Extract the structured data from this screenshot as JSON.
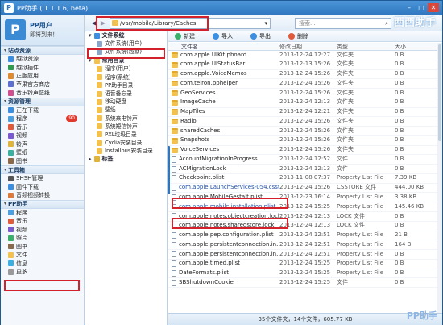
{
  "window": {
    "title": "PP助手 ( 1.1.1.6, beta)",
    "logo": "P",
    "min": "–",
    "max": "□",
    "close": "✕"
  },
  "user": {
    "name": "PP用户",
    "greeting": "即将到来！"
  },
  "left_sections": [
    {
      "title": "站点资源",
      "items": [
        {
          "label": "越狱资源",
          "icon_color": "#3b8ee0"
        },
        {
          "label": "越狱插件",
          "icon_color": "#2e9b4f"
        },
        {
          "label": "正版应用",
          "icon_color": "#e08a2f"
        },
        {
          "label": "苹果官方商店",
          "icon_color": "#5a6fd0"
        },
        {
          "label": "音乐铃声壁纸",
          "icon_color": "#d04f8f"
        }
      ]
    },
    {
      "title": "资源管理",
      "items": [
        {
          "label": "正在下载",
          "icon_color": "#3b8ee0"
        },
        {
          "label": "程序",
          "icon_color": "#4aa0e0",
          "badge": "90"
        },
        {
          "label": "音乐",
          "icon_color": "#e05a3b"
        },
        {
          "label": "视频",
          "icon_color": "#7a5ad0"
        },
        {
          "label": "铃声",
          "icon_color": "#e0b43b"
        },
        {
          "label": "壁纸",
          "icon_color": "#3bb0a0"
        },
        {
          "label": "图书",
          "icon_color": "#8a6a4a"
        }
      ]
    },
    {
      "title": "工具箱",
      "items": [
        {
          "label": "SHSH管理",
          "icon_color": "#555555"
        },
        {
          "label": "固件下载",
          "icon_color": "#3b8ee0"
        },
        {
          "label": "音频视频转换",
          "icon_color": "#e07a3b"
        }
      ]
    },
    {
      "title": "PP助手",
      "items": [
        {
          "label": "程序",
          "icon_color": "#4aa0e0"
        },
        {
          "label": "音乐",
          "icon_color": "#e05a3b"
        },
        {
          "label": "视频",
          "icon_color": "#7a5ad0"
        },
        {
          "label": "照片",
          "icon_color": "#3bb06a"
        },
        {
          "label": "图书",
          "icon_color": "#8a6a4a"
        },
        {
          "label": "文件",
          "icon_color": "#f2c14e"
        },
        {
          "label": "信息",
          "icon_color": "#3bb0e0"
        },
        {
          "label": "更多",
          "icon_color": "#999999"
        }
      ]
    }
  ],
  "path": {
    "back": "◀",
    "forward": "▶",
    "value": "/var/mobile/Library/Caches",
    "dropdown": "▾",
    "search_placeholder": "搜索...",
    "search_icon": "⌕"
  },
  "brand": "西西助手",
  "tree": {
    "fs_title": "文件系统",
    "fs_items": [
      "文件系统(用户)",
      "文件系统(越狱)"
    ],
    "common_title": "常用目录",
    "common_items": [
      "程序(用户)",
      "程序(系统)",
      "PP助手目录",
      "语音备忘录",
      "移动硬盘",
      "壁纸",
      "系统来电铃声",
      "系统短信铃声",
      "PXL垃圾目录",
      "Cydia安装目录",
      "Installous安装目录"
    ],
    "bookmark_title": "标签"
  },
  "actions": [
    "新建",
    "导入",
    "导出",
    "删除"
  ],
  "columns": {
    "name": "文件名",
    "modified": "修改日期",
    "type": "类型",
    "size": "大小"
  },
  "files": [
    {
      "name": "com.apple.UIKit.pboard",
      "date": "2013-12-24 12:27",
      "type": "文件夹",
      "size": "0 B",
      "kind": "folder"
    },
    {
      "name": "com.apple.UIStatusBar",
      "date": "2013-12-13 15:26",
      "type": "文件夹",
      "size": "0 B",
      "kind": "folder"
    },
    {
      "name": "com.apple.VoiceMemos",
      "date": "2013-12-24 15:26",
      "type": "文件夹",
      "size": "0 B",
      "kind": "folder"
    },
    {
      "name": "com.teiron.pphelper",
      "date": "2013-12-24 15:26",
      "type": "文件夹",
      "size": "0 B",
      "kind": "folder"
    },
    {
      "name": "GeoServices",
      "date": "2013-12-24 15:26",
      "type": "文件夹",
      "size": "0 B",
      "kind": "folder"
    },
    {
      "name": "ImageCache",
      "date": "2013-12-24 12:13",
      "type": "文件夹",
      "size": "0 B",
      "kind": "folder"
    },
    {
      "name": "MapTiles",
      "date": "2013-12-24 12:21",
      "type": "文件夹",
      "size": "0 B",
      "kind": "folder"
    },
    {
      "name": "Radio",
      "date": "2013-12-24 15:26",
      "type": "文件夹",
      "size": "0 B",
      "kind": "folder"
    },
    {
      "name": "sharedCaches",
      "date": "2013-12-24 15:26",
      "type": "文件夹",
      "size": "0 B",
      "kind": "folder"
    },
    {
      "name": "Snapshots",
      "date": "2013-12-24 15:26",
      "type": "文件夹",
      "size": "0 B",
      "kind": "folder"
    },
    {
      "name": "VoiceServices",
      "date": "2013-12-24 15:26",
      "type": "文件夹",
      "size": "0 B",
      "kind": "folder"
    },
    {
      "name": "AccountMigrationInProgress",
      "date": "2013-12-24 12:52",
      "type": "文件",
      "size": "0 B",
      "kind": "file"
    },
    {
      "name": "ACMigrationLock",
      "date": "2013-12-24 12:13",
      "type": "文件",
      "size": "0 B",
      "kind": "file"
    },
    {
      "name": "Checkpoint.plist",
      "date": "2013-11-08 07:37",
      "type": "Property List File",
      "size": "7.39 KB",
      "kind": "file"
    },
    {
      "name": "com.apple.LaunchServices-054.csstore",
      "date": "2013-12-24 15:26",
      "type": "CSSTORE 文件",
      "size": "444.00 KB",
      "kind": "file",
      "highlight": true
    },
    {
      "name": "com.apple.MobileGestalt.plist",
      "date": "2013-12-23 16:14",
      "type": "Property List File",
      "size": "3.38 KB",
      "kind": "file"
    },
    {
      "name": "com.apple.mobile.installation.plist",
      "date": "2013-12-24 15:25",
      "type": "Property List File",
      "size": "145.46 KB",
      "kind": "file",
      "highlight": true
    },
    {
      "name": "com.apple.notes.objectcreation.lock",
      "date": "2013-12-24 12:13",
      "type": "LOCK 文件",
      "size": "0 B",
      "kind": "file"
    },
    {
      "name": "com.apple.notes.sharedstore.lock",
      "date": "2013-12-24 12:13",
      "type": "LOCK 文件",
      "size": "0 B",
      "kind": "file"
    },
    {
      "name": "com.apple.pep.configuration.plist",
      "date": "2013-12-24 12:51",
      "type": "Property List File",
      "size": "21 B",
      "kind": "file"
    },
    {
      "name": "com.apple.persistentconnection.in...",
      "date": "2013-12-24 12:51",
      "type": "Property List File",
      "size": "164 B",
      "kind": "file"
    },
    {
      "name": "com.apple.persistentconnection.in...",
      "date": "2013-12-24 12:51",
      "type": "Property List File",
      "size": "0 B",
      "kind": "file"
    },
    {
      "name": "com.apple.timed.plist",
      "date": "2013-12-24 15:25",
      "type": "Property List File",
      "size": "0 B",
      "kind": "file"
    },
    {
      "name": "DateFormats.plist",
      "date": "2013-12-24 15:25",
      "type": "Property List File",
      "size": "0 B",
      "kind": "file"
    },
    {
      "name": "SBShutdownCookie",
      "date": "2013-12-24 15:25",
      "type": "文件",
      "size": "0 B",
      "kind": "file"
    }
  ],
  "status": "35个文件夹，14个文件，605.77 KB",
  "watermark": "PP助手"
}
